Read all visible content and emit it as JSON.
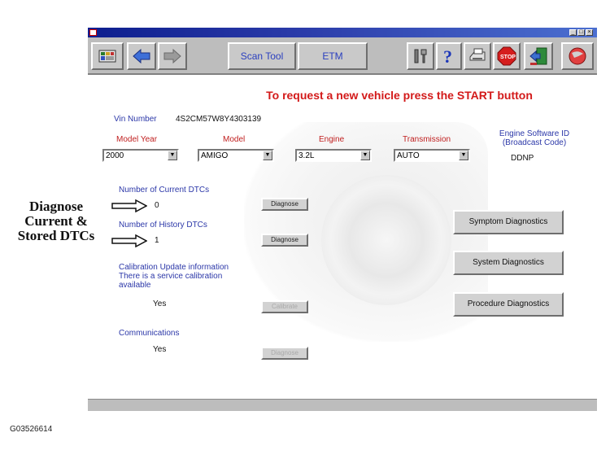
{
  "toolbar": {
    "scan_tool_label": "Scan Tool",
    "etm_label": "ETM"
  },
  "instruction": "To request a new vehicle press the START button",
  "vin": {
    "label": "Vin Number",
    "value": "4S2CM57W8Y4303139"
  },
  "vehicle": {
    "model_year": {
      "label": "Model Year",
      "value": "2000"
    },
    "model": {
      "label": "Model",
      "value": "AMIGO"
    },
    "engine": {
      "label": "Engine",
      "value": "3.2L"
    },
    "transmission": {
      "label": "Transmission",
      "value": "AUTO"
    },
    "software_id": {
      "label_line1": "Engine Software ID",
      "label_line2": "(Broadcast Code)",
      "value": "DDNP"
    }
  },
  "dtc": {
    "current": {
      "label": "Number of Current DTCs",
      "value": "0",
      "button": "Diagnose"
    },
    "history": {
      "label": "Number of History DTCs",
      "value": "1",
      "button": "Diagnose"
    }
  },
  "calibration": {
    "label_line1": "Calibration Update information",
    "label_line2": "There is a service calibration",
    "label_line3": "available",
    "value": "Yes",
    "button": "Calibrate"
  },
  "communications": {
    "label": "Communications",
    "value": "Yes",
    "button": "Diagnose"
  },
  "diagnostics_buttons": {
    "symptom": "Symptom Diagnostics",
    "system": "System  Diagnostics",
    "procedure": "Procedure Diagnostics"
  },
  "annotation": {
    "line1": "Diagnose",
    "line2": "Current &",
    "line3": "Stored DTCs"
  },
  "figure_id": "G03526614",
  "colors": {
    "title_red": "#d31a1a",
    "label_blue": "#2b37a8",
    "label_red": "#c02020",
    "toolbar_gray": "#bdbdbd",
    "titlebar_blue": "#0d1e8e"
  }
}
